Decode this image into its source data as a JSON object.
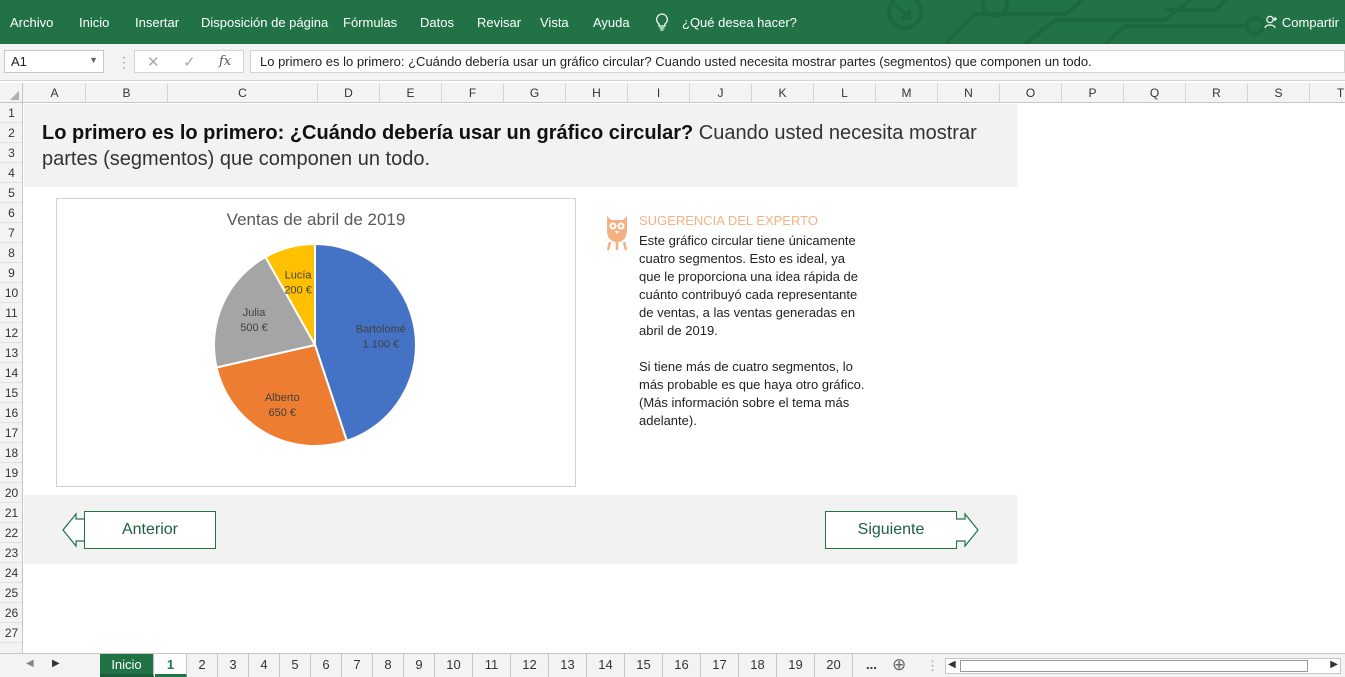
{
  "ribbon": {
    "menus": [
      "Archivo",
      "Inicio",
      "Insertar",
      "Disposición de página",
      "Fórmulas",
      "Datos",
      "Revisar",
      "Vista",
      "Ayuda"
    ],
    "tell_me": "¿Qué desea hacer?",
    "share": "Compartir"
  },
  "formula_bar": {
    "name_box": "A1",
    "content": "Lo primero es lo primero: ¿Cuándo debería usar un gráfico circular? Cuando usted necesita mostrar partes (segmentos) que componen un todo."
  },
  "columns": [
    "A",
    "B",
    "C",
    "D",
    "E",
    "F",
    "G",
    "H",
    "I",
    "J",
    "K",
    "L",
    "M",
    "N",
    "O",
    "P",
    "Q",
    "R",
    "S",
    "T"
  ],
  "rows": [
    "1",
    "2",
    "3",
    "4",
    "5",
    "6",
    "7",
    "8",
    "9",
    "10",
    "11",
    "12",
    "13",
    "14",
    "15",
    "16",
    "17",
    "18",
    "19",
    "20",
    "21",
    "22",
    "23",
    "24",
    "25",
    "26",
    "27"
  ],
  "sheet": {
    "heading_bold": "Lo primero es lo primero: ¿Cuándo debería usar un gráfico circular?",
    "heading_rest": " Cuando usted necesita mostrar partes (segmentos) que componen un todo.",
    "tip_title": "SUGERENCIA DEL EXPERTO",
    "tip_text": "Este gráfico circular tiene únicamente cuatro segmentos. Esto es ideal, ya que le proporciona una idea rápida de cuánto contribuyó cada representante de ventas, a las ventas generadas en abril de 2019.\n\nSi tiene más de cuatro segmentos, lo más probable es que haya otro gráfico. (Más información sobre el tema más adelante).",
    "prev_label": "Anterior",
    "next_label": "Siguiente"
  },
  "chart_data": {
    "type": "pie",
    "title": "Ventas de abril de 2019",
    "categories": [
      "Bartolomé",
      "Alberto",
      "Julia",
      "Lucía"
    ],
    "values": [
      1100,
      650,
      500,
      200
    ],
    "labels": [
      "1.100 €",
      "650 €",
      "500 €",
      "200 €"
    ],
    "colors": [
      "#4472c4",
      "#ed7d31",
      "#a5a5a5",
      "#ffc000"
    ],
    "legend": "none"
  },
  "tabs": {
    "items": [
      "Inicio",
      "1",
      "2",
      "3",
      "4",
      "5",
      "6",
      "7",
      "8",
      "9",
      "10",
      "11",
      "12",
      "13",
      "14",
      "15",
      "16",
      "17",
      "18",
      "19",
      "20"
    ],
    "more": "...",
    "add": "⊕"
  },
  "colors": {
    "brand": "#217346",
    "tip": "#f4b183"
  }
}
